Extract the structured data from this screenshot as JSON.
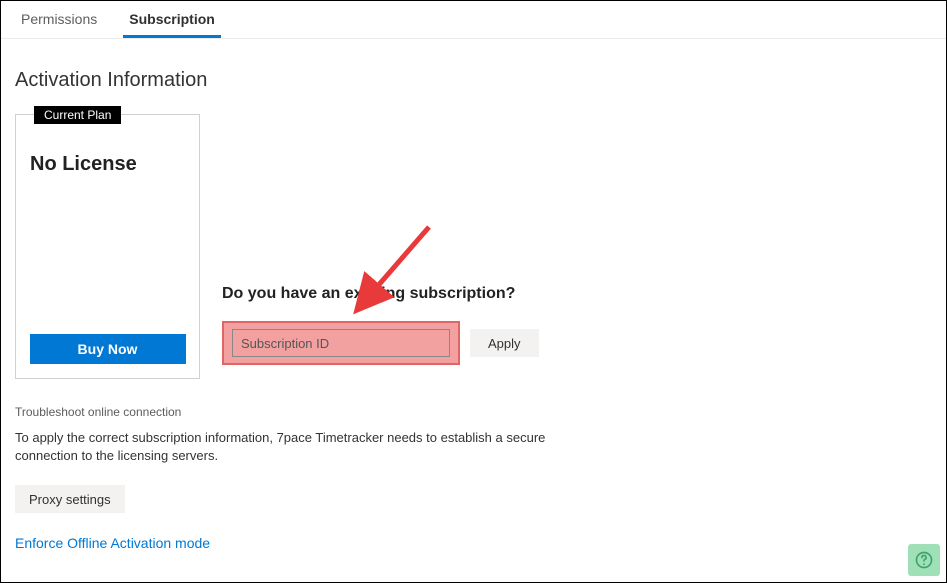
{
  "tabs": {
    "permissions": "Permissions",
    "subscription": "Subscription"
  },
  "page_title": "Activation Information",
  "plan": {
    "badge": "Current Plan",
    "name": "No License",
    "buy_label": "Buy Now"
  },
  "sub_block": {
    "question": "Do you have an existing subscription?",
    "input_placeholder": "Subscription ID",
    "apply_label": "Apply"
  },
  "troubleshoot_title": "Troubleshoot online connection",
  "troubleshoot_desc": "To apply the correct subscription information, 7pace Timetracker needs to establish a secure connection to the licensing servers.",
  "proxy_label": "Proxy settings",
  "offline_link": "Enforce Offline Activation mode"
}
